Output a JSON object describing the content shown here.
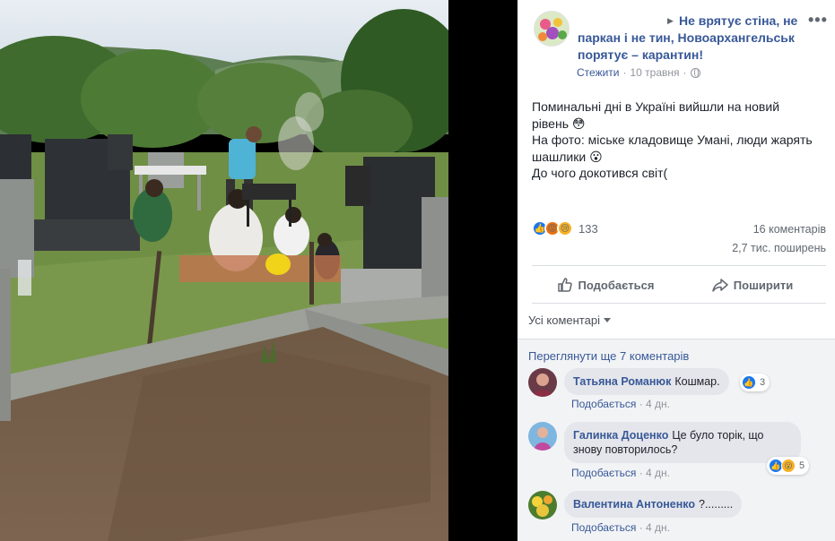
{
  "post": {
    "page_name": "Не врятує стіна, не паркан і не тин, Новоархангельськ порятує – карантин!",
    "follow_label": "Стежити",
    "date": "10 травня",
    "text_lines": [
      "Поминальні дні в Україні вийшли на новий рівень 😳",
      "На фото: міське кладовище Умані, люди жарять шашлики 😮",
      "До чого докотився світ("
    ],
    "reactions": {
      "icons": [
        "like-reaction",
        "angry-reaction",
        "sad-reaction"
      ],
      "count": "133"
    },
    "comments_count": "16 коментарів",
    "shares_count": "2,7 тис. поширень"
  },
  "actions": {
    "like_label": "Подобається",
    "share_label": "Поширити"
  },
  "comments_filter": "Усі коментарі",
  "view_more": "Переглянути ще 7 коментарів",
  "comments": [
    {
      "author": "Татьяна Романюк",
      "text": "Кошмар.",
      "reaction_count": "3",
      "like_label": "Подобається",
      "time": "4 дн."
    },
    {
      "author": "Галинка Доценко",
      "text": "Це було торік, що знову повторилось?",
      "reaction_count": "5",
      "like_label": "Подобається",
      "time": "4 дн."
    },
    {
      "author": "Валентина Антоненко",
      "text": "?.........",
      "like_label": "Подобається",
      "time": "4 дн."
    }
  ],
  "colors": {
    "link": "#385898",
    "meta": "#90949c",
    "like_blue": "#1877f2",
    "comment_bubble": "#e4e6eb"
  }
}
